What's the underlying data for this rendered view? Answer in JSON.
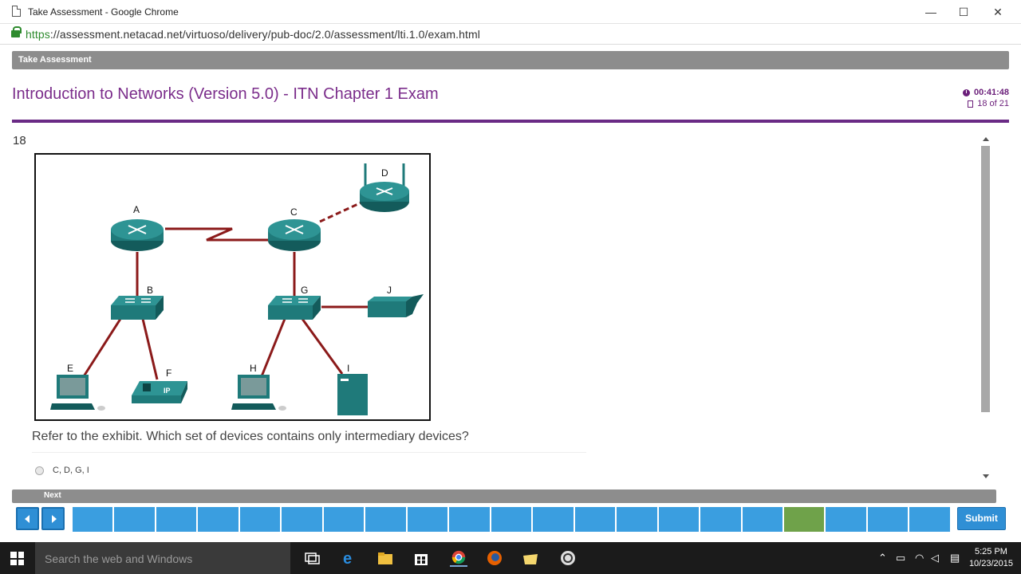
{
  "window": {
    "title": "Take Assessment - Google Chrome",
    "minimize": "—",
    "maximize": "☐",
    "close": "✕"
  },
  "urlbar": {
    "protocol": "https",
    "rest": "://assessment.netacad.net/virtuoso/delivery/pub-doc/2.0/assessment/lti.1.0/exam.html"
  },
  "assessment": {
    "header_label": "Take Assessment",
    "title": "Introduction to Networks (Version 5.0) - ITN Chapter 1 Exam",
    "timer": "00:41:48",
    "progress": "18 of 21"
  },
  "question": {
    "number": "18",
    "text": "Refer to the exhibit. Which set of devices contains only intermediary devices?",
    "options": [
      {
        "label": "C, D, G, I",
        "selected": false
      }
    ]
  },
  "exhibit": {
    "labels": {
      "A": "A",
      "B": "B",
      "C": "C",
      "D": "D",
      "E": "E",
      "F": "F",
      "G": "G",
      "H": "H",
      "I": "I",
      "J": "J"
    },
    "phone_label": "IP"
  },
  "footer": {
    "next_label": "Next",
    "submit_label": "Submit",
    "total_questions": 21,
    "current_question": 18
  },
  "taskbar": {
    "search_placeholder": "Search the web and Windows",
    "time": "5:25 PM",
    "date": "10/23/2015"
  },
  "colors": {
    "accent_purple": "#6a2a85",
    "nav_blue": "#3a9ee0",
    "current_green": "#6fa24a",
    "link_red": "#8b1a1a",
    "device_teal": "#1f7a7a"
  }
}
